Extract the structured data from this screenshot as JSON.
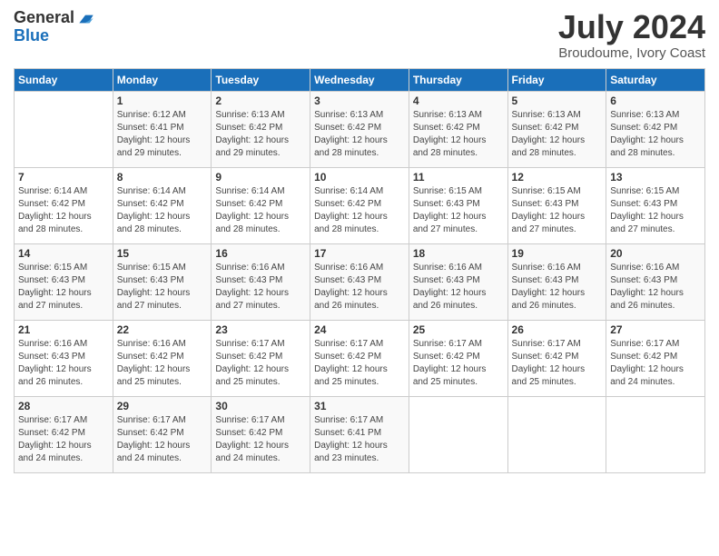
{
  "logo": {
    "general": "General",
    "blue": "Blue"
  },
  "title": "July 2024",
  "location": "Broudoume, Ivory Coast",
  "days_of_week": [
    "Sunday",
    "Monday",
    "Tuesday",
    "Wednesday",
    "Thursday",
    "Friday",
    "Saturday"
  ],
  "weeks": [
    [
      {
        "day": "",
        "info": ""
      },
      {
        "day": "1",
        "info": "Sunrise: 6:12 AM\nSunset: 6:41 PM\nDaylight: 12 hours\nand 29 minutes."
      },
      {
        "day": "2",
        "info": "Sunrise: 6:13 AM\nSunset: 6:42 PM\nDaylight: 12 hours\nand 29 minutes."
      },
      {
        "day": "3",
        "info": "Sunrise: 6:13 AM\nSunset: 6:42 PM\nDaylight: 12 hours\nand 28 minutes."
      },
      {
        "day": "4",
        "info": "Sunrise: 6:13 AM\nSunset: 6:42 PM\nDaylight: 12 hours\nand 28 minutes."
      },
      {
        "day": "5",
        "info": "Sunrise: 6:13 AM\nSunset: 6:42 PM\nDaylight: 12 hours\nand 28 minutes."
      },
      {
        "day": "6",
        "info": "Sunrise: 6:13 AM\nSunset: 6:42 PM\nDaylight: 12 hours\nand 28 minutes."
      }
    ],
    [
      {
        "day": "7",
        "info": "Sunrise: 6:14 AM\nSunset: 6:42 PM\nDaylight: 12 hours\nand 28 minutes."
      },
      {
        "day": "8",
        "info": "Sunrise: 6:14 AM\nSunset: 6:42 PM\nDaylight: 12 hours\nand 28 minutes."
      },
      {
        "day": "9",
        "info": "Sunrise: 6:14 AM\nSunset: 6:42 PM\nDaylight: 12 hours\nand 28 minutes."
      },
      {
        "day": "10",
        "info": "Sunrise: 6:14 AM\nSunset: 6:42 PM\nDaylight: 12 hours\nand 28 minutes."
      },
      {
        "day": "11",
        "info": "Sunrise: 6:15 AM\nSunset: 6:43 PM\nDaylight: 12 hours\nand 27 minutes."
      },
      {
        "day": "12",
        "info": "Sunrise: 6:15 AM\nSunset: 6:43 PM\nDaylight: 12 hours\nand 27 minutes."
      },
      {
        "day": "13",
        "info": "Sunrise: 6:15 AM\nSunset: 6:43 PM\nDaylight: 12 hours\nand 27 minutes."
      }
    ],
    [
      {
        "day": "14",
        "info": "Sunrise: 6:15 AM\nSunset: 6:43 PM\nDaylight: 12 hours\nand 27 minutes."
      },
      {
        "day": "15",
        "info": "Sunrise: 6:15 AM\nSunset: 6:43 PM\nDaylight: 12 hours\nand 27 minutes."
      },
      {
        "day": "16",
        "info": "Sunrise: 6:16 AM\nSunset: 6:43 PM\nDaylight: 12 hours\nand 27 minutes."
      },
      {
        "day": "17",
        "info": "Sunrise: 6:16 AM\nSunset: 6:43 PM\nDaylight: 12 hours\nand 26 minutes."
      },
      {
        "day": "18",
        "info": "Sunrise: 6:16 AM\nSunset: 6:43 PM\nDaylight: 12 hours\nand 26 minutes."
      },
      {
        "day": "19",
        "info": "Sunrise: 6:16 AM\nSunset: 6:43 PM\nDaylight: 12 hours\nand 26 minutes."
      },
      {
        "day": "20",
        "info": "Sunrise: 6:16 AM\nSunset: 6:43 PM\nDaylight: 12 hours\nand 26 minutes."
      }
    ],
    [
      {
        "day": "21",
        "info": "Sunrise: 6:16 AM\nSunset: 6:43 PM\nDaylight: 12 hours\nand 26 minutes."
      },
      {
        "day": "22",
        "info": "Sunrise: 6:16 AM\nSunset: 6:42 PM\nDaylight: 12 hours\nand 25 minutes."
      },
      {
        "day": "23",
        "info": "Sunrise: 6:17 AM\nSunset: 6:42 PM\nDaylight: 12 hours\nand 25 minutes."
      },
      {
        "day": "24",
        "info": "Sunrise: 6:17 AM\nSunset: 6:42 PM\nDaylight: 12 hours\nand 25 minutes."
      },
      {
        "day": "25",
        "info": "Sunrise: 6:17 AM\nSunset: 6:42 PM\nDaylight: 12 hours\nand 25 minutes."
      },
      {
        "day": "26",
        "info": "Sunrise: 6:17 AM\nSunset: 6:42 PM\nDaylight: 12 hours\nand 25 minutes."
      },
      {
        "day": "27",
        "info": "Sunrise: 6:17 AM\nSunset: 6:42 PM\nDaylight: 12 hours\nand 24 minutes."
      }
    ],
    [
      {
        "day": "28",
        "info": "Sunrise: 6:17 AM\nSunset: 6:42 PM\nDaylight: 12 hours\nand 24 minutes."
      },
      {
        "day": "29",
        "info": "Sunrise: 6:17 AM\nSunset: 6:42 PM\nDaylight: 12 hours\nand 24 minutes."
      },
      {
        "day": "30",
        "info": "Sunrise: 6:17 AM\nSunset: 6:42 PM\nDaylight: 12 hours\nand 24 minutes."
      },
      {
        "day": "31",
        "info": "Sunrise: 6:17 AM\nSunset: 6:41 PM\nDaylight: 12 hours\nand 23 minutes."
      },
      {
        "day": "",
        "info": ""
      },
      {
        "day": "",
        "info": ""
      },
      {
        "day": "",
        "info": ""
      }
    ]
  ]
}
